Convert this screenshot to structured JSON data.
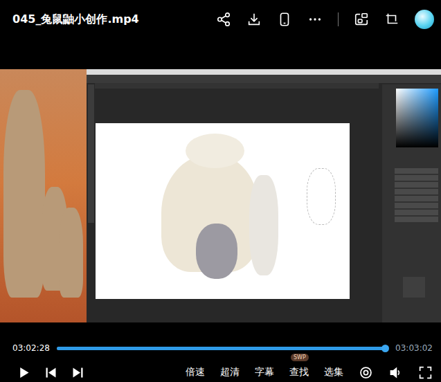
{
  "video": {
    "title": "045_兔鼠鼬小创作.mp4"
  },
  "player": {
    "current_time": "03:02:28",
    "duration": "03:03:02",
    "level": 0.99
  },
  "controls": [
    {
      "label": "倍速"
    },
    {
      "label": "超清"
    },
    {
      "label": "字幕"
    },
    {
      "label": "查找",
      "badge": "SWP"
    },
    {
      "label": "选集"
    }
  ]
}
